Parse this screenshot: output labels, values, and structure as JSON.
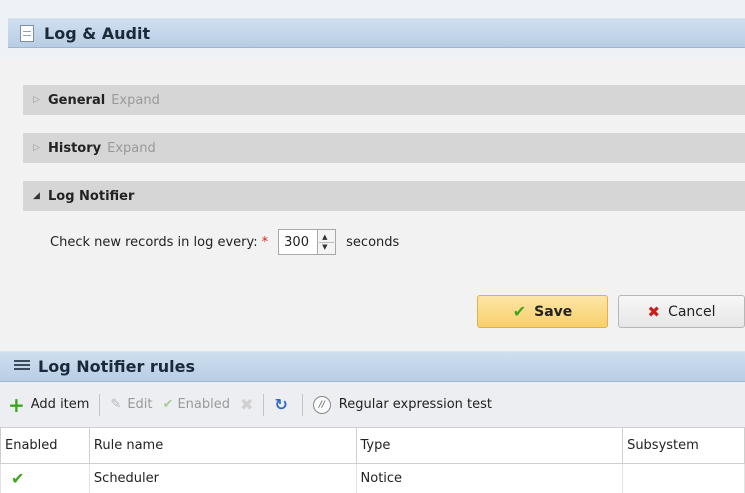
{
  "panel": {
    "title": "Log & Audit",
    "icon": "document-icon"
  },
  "sections": {
    "general": {
      "label": "General",
      "expand": "Expand"
    },
    "history": {
      "label": "History",
      "expand": "Expand"
    },
    "log_notifier": {
      "label": "Log Notifier"
    }
  },
  "check_setting": {
    "label": "Check new records in log every:",
    "required_mark": "*",
    "value": "300",
    "unit": "seconds"
  },
  "buttons": {
    "save": "Save",
    "cancel": "Cancel"
  },
  "rules_panel": {
    "title": "Log Notifier rules"
  },
  "toolbar": {
    "add_item": "Add item",
    "edit": "Edit",
    "enabled": "Enabled",
    "regex_test": "Regular expression test"
  },
  "table": {
    "columns": [
      "Enabled",
      "Rule name",
      "Type",
      "Subsystem"
    ],
    "rows": [
      {
        "enabled": "✔",
        "rule_name": "Scheduler",
        "type": "Notice",
        "subsystem": ""
      }
    ]
  },
  "colors": {
    "header_blue": "#b8cde4",
    "save_button": "#f8cf6a",
    "check_green": "#3fa51a",
    "cancel_red": "#c8201e"
  }
}
